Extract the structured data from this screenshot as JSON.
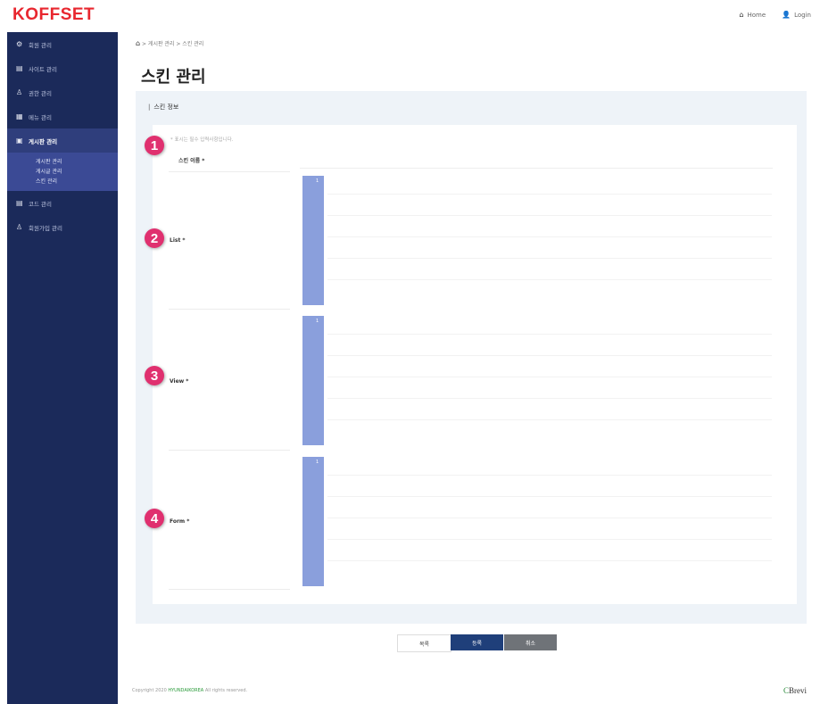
{
  "header": {
    "logo": "KOFFSET",
    "home_label": "Home",
    "login_label": "Login"
  },
  "sidebar": {
    "items": [
      {
        "label": "회원 관리",
        "icon": "gear-icon"
      },
      {
        "label": "사이트 관리",
        "icon": "list-icon"
      },
      {
        "label": "권한 관리",
        "icon": "users-icon"
      },
      {
        "label": "메뉴 관리",
        "icon": "menu-icon"
      },
      {
        "label": "게시판 관리",
        "icon": "board-icon",
        "active": true
      },
      {
        "label": "코드 관리",
        "icon": "code-icon"
      },
      {
        "label": "회원가입 관리",
        "icon": "user-add-icon"
      }
    ],
    "subitems": [
      "게시판 관리",
      "게시글 관리",
      "스킨 관리"
    ]
  },
  "breadcrumb": "게시판 관리 > 스킨 관리",
  "page_title": "스킨 관리",
  "panel_title": "스킨 정보",
  "notice": "* 표시는 필수 입력사항입니다.",
  "form": {
    "skin_name_label": "스킨 이름 *",
    "list_label": "List *",
    "view_label": "View *",
    "form_label": "Form *",
    "line_number": "1"
  },
  "badges": [
    "1",
    "2",
    "3",
    "4"
  ],
  "buttons": {
    "list": "목록",
    "save": "등록",
    "cancel": "취소"
  },
  "footer": {
    "text_prefix": "Copyright 2020",
    "brand": "HYUNDAIKOREA",
    "text_suffix": "All rights reserved.",
    "logo": "Brevi"
  },
  "colors": {
    "sidebar": "#1b2a5a",
    "accent_badge": "#e0306f",
    "logo_red": "#e8272f",
    "gutter": "#8a9fdc",
    "save_button": "#1f3f7a"
  }
}
